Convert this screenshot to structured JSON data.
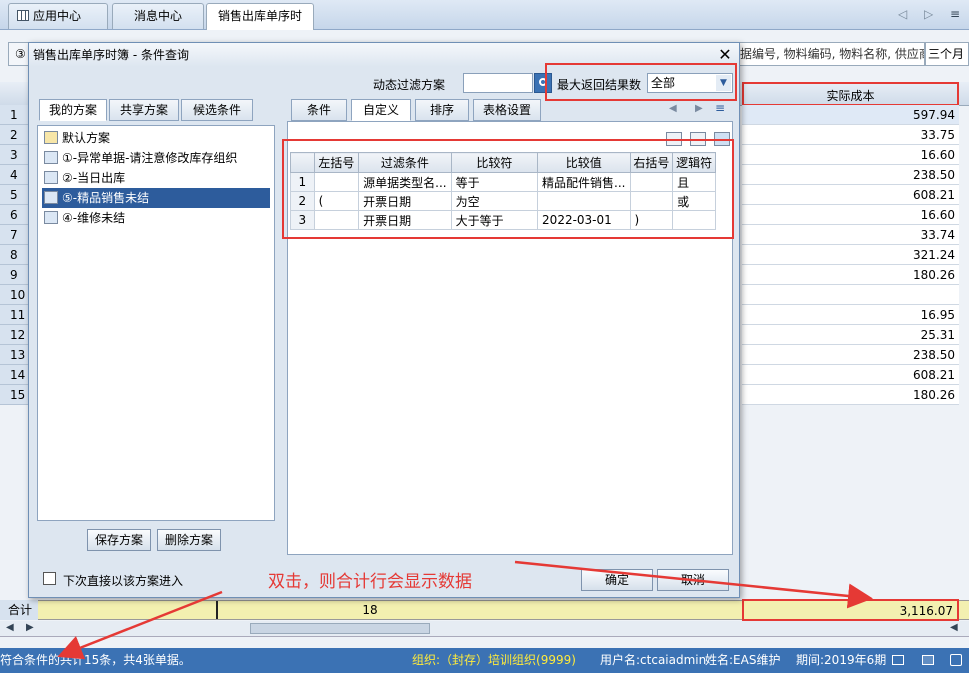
{
  "tabs": [
    {
      "label": "应用中心",
      "icon": "grid-icon"
    },
    {
      "label": "消息中心"
    },
    {
      "label": "销售出库单序时簿"
    }
  ],
  "toolbar": {
    "circle_label": "③",
    "search_placeholder": "据编号, 物料编码, 物料名称, 供应商",
    "period": "三个月"
  },
  "grid": {
    "cost_header": "实际成本",
    "rows": [
      {
        "n": "1",
        "cost": "597.94"
      },
      {
        "n": "2",
        "cost": "33.75"
      },
      {
        "n": "3",
        "cost": "16.60"
      },
      {
        "n": "4",
        "cost": "238.50"
      },
      {
        "n": "5",
        "cost": "608.21"
      },
      {
        "n": "6",
        "cost": "16.60"
      },
      {
        "n": "7",
        "cost": "33.74"
      },
      {
        "n": "8",
        "cost": "321.24"
      },
      {
        "n": "9",
        "cost": "180.26"
      },
      {
        "n": "10",
        "cost": ""
      },
      {
        "n": "11",
        "cost": "16.95"
      },
      {
        "n": "12",
        "cost": "25.31"
      },
      {
        "n": "13",
        "cost": "238.50"
      },
      {
        "n": "14",
        "cost": "608.21"
      },
      {
        "n": "15",
        "cost": "180.26"
      }
    ],
    "sum_label": "合计",
    "sum_count": "18",
    "sum_total": "3,116.07"
  },
  "status": {
    "left": "符合条件的共计15条，共4张单据。",
    "org": "组织:（封存）培训组织(9999)",
    "user": "用户名:ctcaiadmin",
    "name": "姓名:EAS维护",
    "period": "期间:2019年6期"
  },
  "dialog": {
    "title": "销售出库单序时簿 - 条件查询",
    "dynamic_label": "动态过滤方案",
    "max_label": "最大返回结果数",
    "max_value": "全部",
    "left_tabs": [
      "我的方案",
      "共享方案",
      "候选条件"
    ],
    "schemes": [
      {
        "label": "默认方案",
        "icon": "folder-icon"
      },
      {
        "label": "①-异常单据-请注意修改库存组织",
        "icon": "scheme-icon"
      },
      {
        "label": "②-当日出库",
        "icon": "scheme-icon"
      },
      {
        "label": "⑤-精品销售未结",
        "icon": "scheme-icon"
      },
      {
        "label": "④-维修未结",
        "icon": "scheme-icon"
      }
    ],
    "save_button": "保存方案",
    "delete_button": "删除方案",
    "right_tabs": [
      "条件",
      "自定义",
      "排序",
      "表格设置"
    ],
    "table_headers": [
      "左括号",
      "过滤条件",
      "比较符",
      "比较值",
      "右括号",
      "逻辑符"
    ],
    "table_rows": [
      [
        "1",
        "",
        "源单据类型名...",
        "等于",
        "精品配件销售...",
        "",
        "且"
      ],
      [
        "2",
        "(",
        "开票日期",
        "为空",
        "",
        "",
        "或"
      ],
      [
        "3",
        "",
        "开票日期",
        "大于等于",
        "2022-03-01",
        ")",
        ""
      ]
    ],
    "checkbox_label": "下次直接以该方案进入",
    "ok_button": "确定",
    "cancel_button": "取消"
  },
  "annotation": "双击，则合计行会显示数据",
  "colors": {
    "accent": "#e53935",
    "selection": "#2d5c9c",
    "status_bg": "#3b72b4"
  }
}
